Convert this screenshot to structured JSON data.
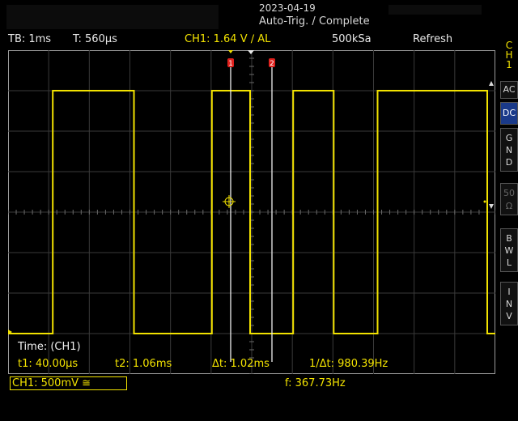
{
  "header": {
    "date": "2023-04-19",
    "trigger_status": "Auto-Trig. / Complete"
  },
  "status_bar": {
    "timebase": "TB: 1ms",
    "trigger_time": "T: 560µs",
    "channel": "CH1: 1.64 V ∕ AL",
    "sample_rate": "500kSa",
    "mode": "Refresh"
  },
  "side_panel": {
    "channel_tab": "C\nH\n1",
    "coupling_ac": "AC",
    "coupling_dc": "DC",
    "ground": "G\nN\nD",
    "impedance": "50\nΩ",
    "bandwidth_limit": "B\nW\nL",
    "invert": "I\nN\nV"
  },
  "cursors": {
    "label_1": "1",
    "label_2": "2"
  },
  "measurements": {
    "time_label": "Time: (CH1)",
    "t1": "t1: 40.00µs",
    "t2": "t2: 1.06ms",
    "delta_t": "Δt: 1.02ms",
    "inv_delta_t": "1/Δt: 980.39Hz"
  },
  "footer": {
    "channel_scale": "CH1: 500mV ≅",
    "frequency": "f: 367.73Hz"
  },
  "colors": {
    "trace": "#f2e200",
    "grid": "#3a3a3a",
    "cursor": "#f0f0f0",
    "cursor_marker": "#e0201c",
    "active_button": "#1a3a8a"
  },
  "chart_data": {
    "type": "line",
    "title": "",
    "xlabel": "",
    "ylabel": "",
    "timebase": "1ms/div",
    "vertical_scale": "500mV/div",
    "xlim_ms": [
      -5.56,
      6.44
    ],
    "ylim_div": [
      -4,
      4
    ],
    "series": [
      {
        "name": "CH1",
        "x_ms": [
          -5.56,
          -4.46,
          -4.46,
          -2.46,
          -2.46,
          -0.54,
          -0.54,
          0.4,
          0.4,
          1.46,
          1.46,
          2.46,
          2.46,
          3.54,
          3.54,
          4.46,
          4.46,
          6.24,
          6.24,
          6.44
        ],
        "y_div": [
          -3.0,
          -3.0,
          3.0,
          3.0,
          -3.0,
          -3.0,
          3.0,
          3.0,
          -3.0,
          -3.0,
          3.0,
          3.0,
          -3.0,
          -3.0,
          3.0,
          3.0,
          3.0,
          3.0,
          -3.0,
          -3.0
        ]
      }
    ]
  }
}
